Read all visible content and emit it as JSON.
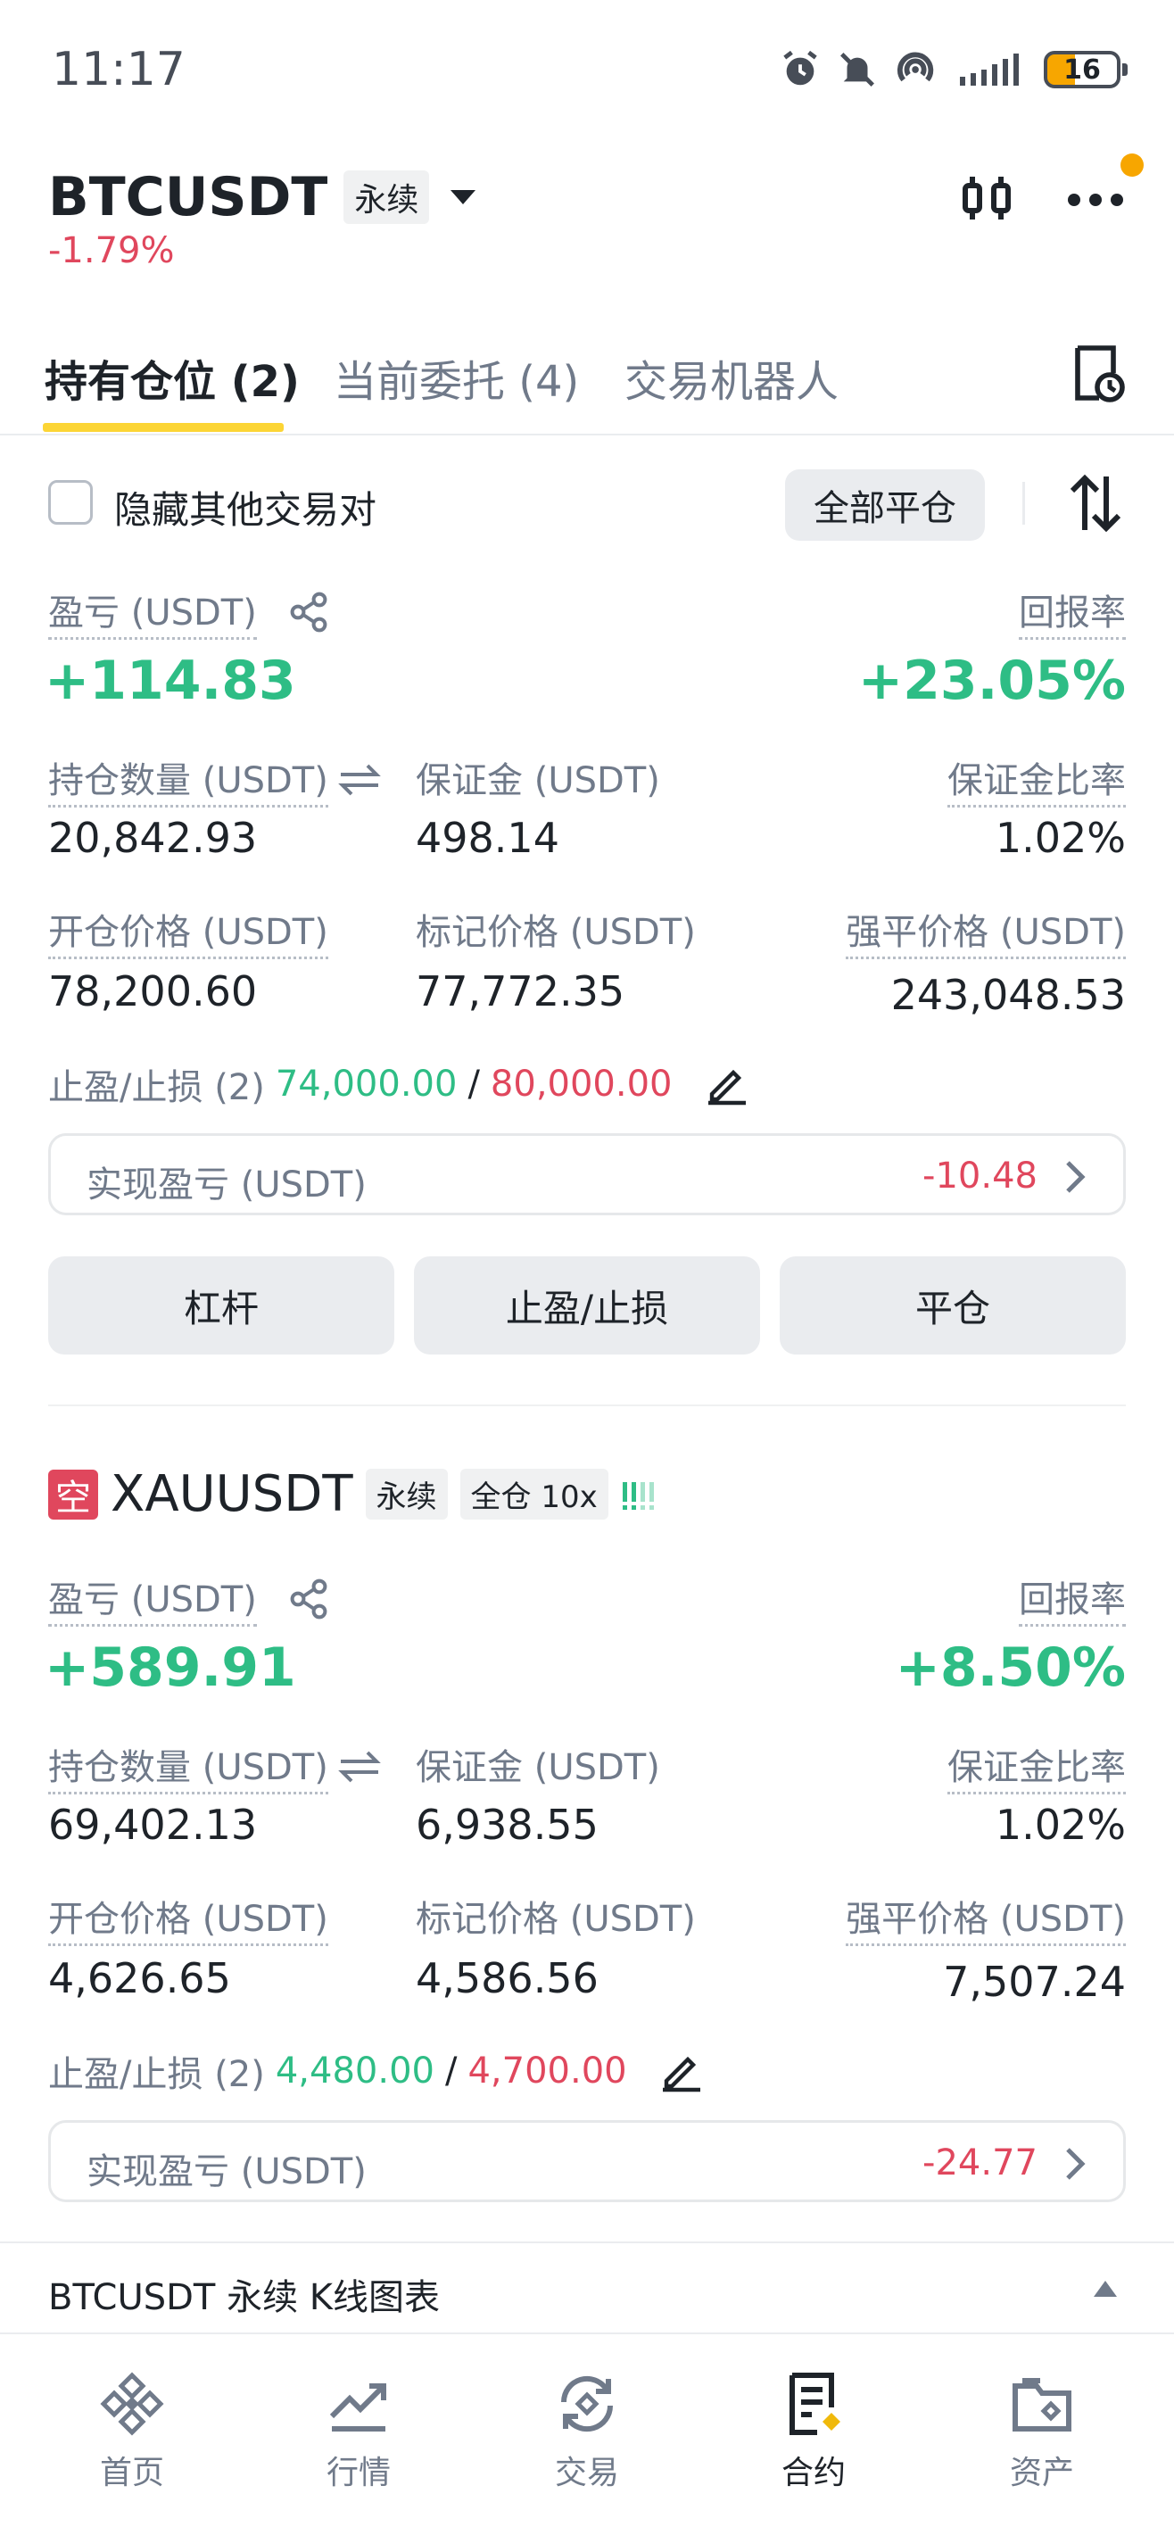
{
  "status": {
    "time": "11:17",
    "battery": "16"
  },
  "header": {
    "symbol": "BTCUSDT",
    "contract_tag": "永续",
    "change": "-1.79%"
  },
  "tabs": [
    {
      "label": "持有仓位 (2)"
    },
    {
      "label": "当前委托 (4)"
    },
    {
      "label": "交易机器人"
    }
  ],
  "controls": {
    "hide_other_pairs": "隐藏其他交易对",
    "close_all": "全部平仓"
  },
  "labels": {
    "pnl": "盈亏 (USDT)",
    "roi": "回报率",
    "size": "持仓数量 (USDT)",
    "margin": "保证金 (USDT)",
    "margin_ratio": "保证金比率",
    "entry": "开仓价格 (USDT)",
    "mark": "标记价格 (USDT)",
    "liq": "强平价格 (USDT)",
    "tpsl_prefix": "止盈/止损 (2)",
    "realized": "实现盈亏 (USDT)"
  },
  "positions": [
    {
      "pnl": "+114.83",
      "roi": "+23.05%",
      "size": "20,842.93",
      "margin": "498.14",
      "margin_ratio": "1.02%",
      "entry": "78,200.60",
      "mark": "77,772.35",
      "liq": "243,048.53",
      "tp": "74,000.00",
      "sl": "80,000.00",
      "realized": "-10.48"
    },
    {
      "side_badge": "空",
      "symbol": "XAUUSDT",
      "contract_tag": "永续",
      "margin_tag": "全仓 10x",
      "pnl": "+589.91",
      "roi": "+8.50%",
      "size": "69,402.13",
      "margin": "6,938.55",
      "margin_ratio": "1.02%",
      "entry": "4,626.65",
      "mark": "4,586.56",
      "liq": "7,507.24",
      "tp": "4,480.00",
      "sl": "4,700.00",
      "realized": "-24.77"
    }
  ],
  "actions": {
    "leverage": "杠杆",
    "tpsl": "止盈/止损",
    "close": "平仓"
  },
  "kline_bar": {
    "label": "BTCUSDT 永续 K线图表"
  },
  "nav": [
    {
      "label": "首页",
      "icon": "home-icon"
    },
    {
      "label": "行情",
      "icon": "markets-icon"
    },
    {
      "label": "交易",
      "icon": "trade-icon"
    },
    {
      "label": "合约",
      "icon": "futures-icon"
    },
    {
      "label": "资产",
      "icon": "assets-icon"
    }
  ],
  "colors": {
    "accent": "#fcd535",
    "profit": "#2ebd85",
    "loss": "#e0475d",
    "notification_dot": "#f7a600"
  }
}
